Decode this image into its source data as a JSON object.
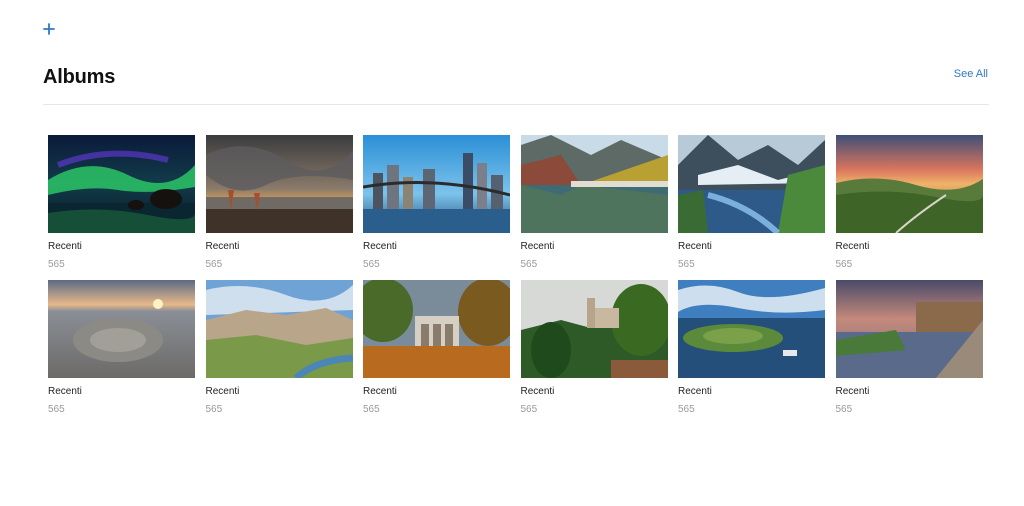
{
  "toolbar": {
    "add_icon": "plus-icon",
    "accent": "#2f79c8"
  },
  "header": {
    "title": "Albums",
    "see_all": "See All"
  },
  "albums": [
    {
      "label": "Recenti",
      "count": "565",
      "thumb": "aurora-lake"
    },
    {
      "label": "Recenti",
      "count": "565",
      "thumb": "storm-beach"
    },
    {
      "label": "Recenti",
      "count": "565",
      "thumb": "city-bridge"
    },
    {
      "label": "Recenti",
      "count": "565",
      "thumb": "mountain-lake"
    },
    {
      "label": "Recenti",
      "count": "565",
      "thumb": "glacier-valley"
    },
    {
      "label": "Recenti",
      "count": "565",
      "thumb": "sunset-hills"
    },
    {
      "label": "Recenti",
      "count": "565",
      "thumb": "rocky-desert"
    },
    {
      "label": "Recenti",
      "count": "565",
      "thumb": "hill-town"
    },
    {
      "label": "Recenti",
      "count": "565",
      "thumb": "triumphal-arch"
    },
    {
      "label": "Recenti",
      "count": "565",
      "thumb": "castle-forest"
    },
    {
      "label": "Recenti",
      "count": "565",
      "thumb": "island-harbor"
    },
    {
      "label": "Recenti",
      "count": "565",
      "thumb": "river-town"
    }
  ]
}
